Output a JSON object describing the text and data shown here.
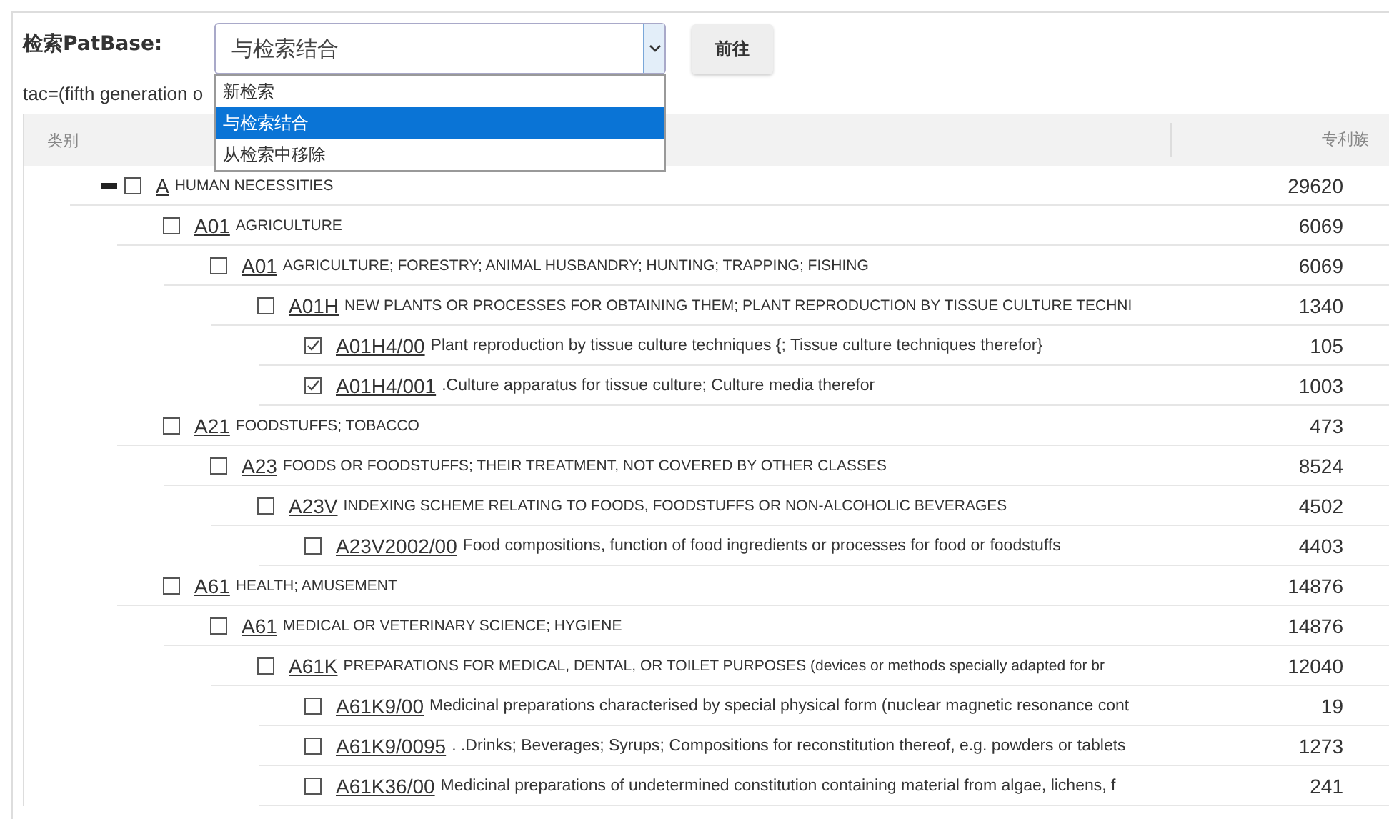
{
  "search": {
    "label": "检索PatBase:",
    "select_value": "与检索结合",
    "options": [
      {
        "label": "新检索",
        "selected": false
      },
      {
        "label": "与检索结合",
        "selected": true
      },
      {
        "label": "从检索中移除",
        "selected": false
      }
    ],
    "button": "前往",
    "query": "tac=(fifth generation o"
  },
  "table": {
    "columns": [
      "类别",
      "专利族"
    ],
    "rows": [
      {
        "code": "A",
        "description": "HUMAN NECESSITIES",
        "count": "29620",
        "checked": false,
        "expanded": true,
        "children": [
          {
            "code": "A01",
            "description": "AGRICULTURE",
            "count": "6069",
            "checked": false,
            "children": [
              {
                "code": "A01",
                "description": "AGRICULTURE; FORESTRY; ANIMAL HUSBANDRY; HUNTING; TRAPPING; FISHING",
                "count": "6069",
                "checked": false,
                "children": [
                  {
                    "code": "A01H",
                    "description": "NEW PLANTS OR PROCESSES FOR OBTAINING THEM; PLANT REPRODUCTION BY TISSUE CULTURE TECHNI",
                    "count": "1340",
                    "checked": false,
                    "children": [
                      {
                        "code": "A01H4/00",
                        "description": "Plant reproduction by tissue culture techniques {; Tissue culture techniques therefor}",
                        "count": "105",
                        "checked": true
                      },
                      {
                        "code": "A01H4/001",
                        "description": ".Culture apparatus for tissue culture; Culture media therefor",
                        "count": "1003",
                        "checked": true
                      }
                    ]
                  }
                ]
              }
            ]
          },
          {
            "code": "A21",
            "description": "FOODSTUFFS; TOBACCO",
            "count": "473",
            "checked": false,
            "children": [
              {
                "code": "A23",
                "description": "FOODS OR FOODSTUFFS; THEIR TREATMENT, NOT COVERED BY OTHER CLASSES",
                "count": "8524",
                "checked": false,
                "children": [
                  {
                    "code": "A23V",
                    "description": "INDEXING SCHEME RELATING TO FOODS, FOODSTUFFS OR NON-ALCOHOLIC BEVERAGES",
                    "count": "4502",
                    "checked": false,
                    "children": [
                      {
                        "code": "A23V2002/00",
                        "description": "Food compositions, function of food ingredients or processes for food or foodstuffs",
                        "count": "4403",
                        "checked": false
                      }
                    ]
                  }
                ]
              }
            ]
          },
          {
            "code": "A61",
            "description": "HEALTH; AMUSEMENT",
            "count": "14876",
            "checked": false,
            "children": [
              {
                "code": "A61",
                "description": "MEDICAL OR VETERINARY SCIENCE; HYGIENE",
                "count": "14876",
                "checked": false,
                "children": [
                  {
                    "code": "A61K",
                    "description": "PREPARATIONS FOR MEDICAL, DENTAL, OR TOILET PURPOSES (devices or methods specially adapted for br",
                    "count": "12040",
                    "checked": false,
                    "children": [
                      {
                        "code": "A61K9/00",
                        "description": "Medicinal preparations characterised by special physical form (nuclear magnetic resonance cont",
                        "count": "19",
                        "checked": false
                      },
                      {
                        "code": "A61K9/0095",
                        "description": ". .Drinks; Beverages; Syrups; Compositions for reconstitution thereof, e.g. powders or tablets",
                        "count": "1273",
                        "checked": false
                      },
                      {
                        "code": "A61K36/00",
                        "description": "Medicinal preparations of undetermined constitution containing material from algae, lichens, f",
                        "count": "241",
                        "checked": false
                      }
                    ]
                  }
                ]
              }
            ]
          }
        ]
      }
    ]
  }
}
